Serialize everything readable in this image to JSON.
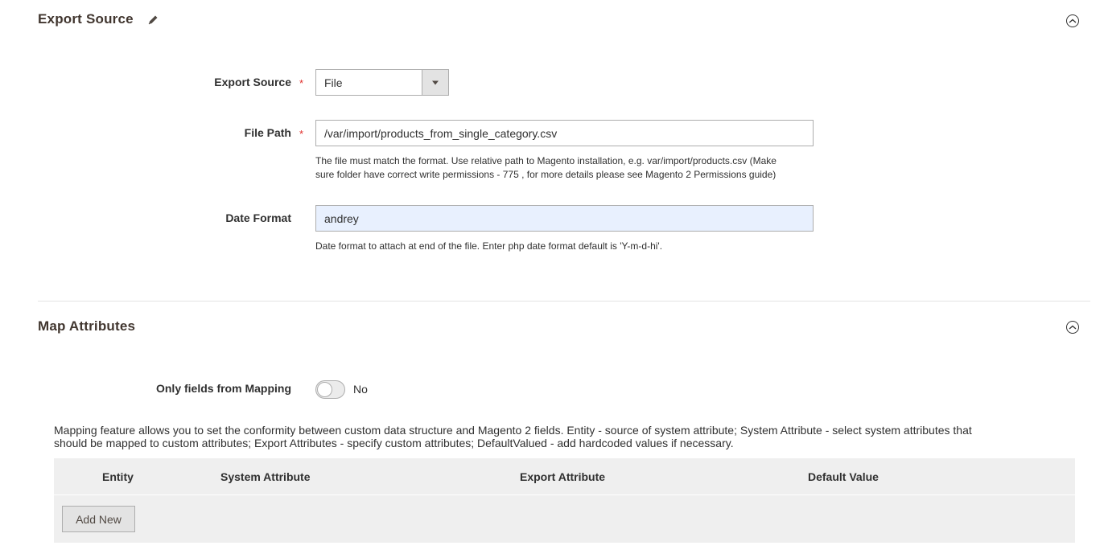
{
  "export_source_section": {
    "title": "Export Source",
    "fields": {
      "export_source": {
        "label": "Export Source",
        "required": "*",
        "value": "File"
      },
      "file_path": {
        "label": "File Path",
        "required": "*",
        "value": "/var/import/products_from_single_category.csv",
        "note_line1": "The file must match the format. Use relative path to Magento installation, e.g. var/import/products.csv (Make",
        "note_line2": "sure folder have correct write permissions - 775 , for more details please see Magento 2 Permissions guide)"
      },
      "date_format": {
        "label": "Date Format",
        "value": "andrey",
        "note": "Date format to attach at end of the file. Enter php date format default is 'Y-m-d-hi'."
      }
    }
  },
  "map_attributes_section": {
    "title": "Map Attributes",
    "only_fields_from_mapping": {
      "label": "Only fields from Mapping",
      "state": "No"
    },
    "description_line1": "Mapping feature allows you to set the conformity between custom data structure and Magento 2 fields. Entity - source of system attribute; System Attribute - select system attributes that",
    "description_line2": "should be mapped to custom attributes; Export Attributes - specify custom attributes; DefaultValued - add hardcoded values if necessary.",
    "table": {
      "columns": [
        "Entity",
        "System Attribute",
        "Export Attribute",
        "Default Value"
      ],
      "add_new_label": "Add New"
    }
  }
}
